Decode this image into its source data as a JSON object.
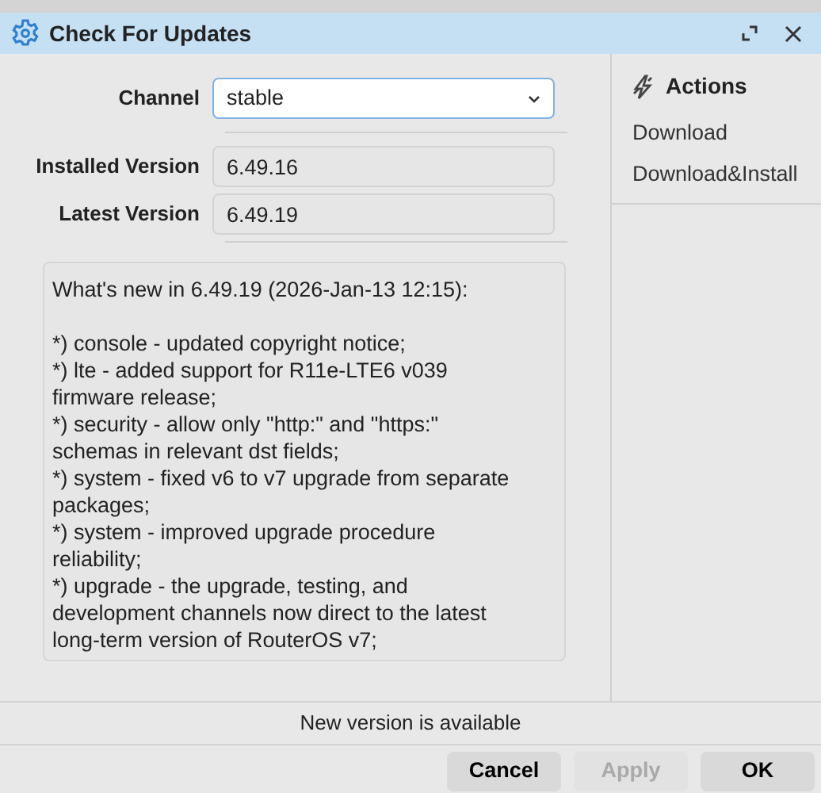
{
  "window": {
    "title": "Check For Updates"
  },
  "channel": {
    "label": "Channel",
    "value": "stable"
  },
  "versions": [
    {
      "label": "Installed Version",
      "value": "6.49.16"
    },
    {
      "label": "Latest Version",
      "value": "6.49.19"
    }
  ],
  "notes": {
    "heading": "What's new in 6.49.19  (2026-Jan-13 12:15):",
    "items": [
      "*) console - updated copyright notice;",
      "*) lte - added support for R11e-LTE6 v039 firmware release;",
      "*) security - allow only \"http:\" and \"https:\" schemas in relevant dst fields;",
      "*) system - fixed v6 to v7 upgrade from separate packages;",
      "*) system - improved upgrade procedure reliability;",
      "*) upgrade - the upgrade, testing, and development channels now direct to the latest long-term version of RouterOS v7;"
    ]
  },
  "actions": {
    "title": "Actions",
    "items": [
      "Download",
      "Download&Install"
    ]
  },
  "status": "New version is available",
  "buttons": [
    {
      "label": "Cancel",
      "disabled": false
    },
    {
      "label": "Apply",
      "disabled": true
    },
    {
      "label": "OK",
      "disabled": false
    }
  ]
}
